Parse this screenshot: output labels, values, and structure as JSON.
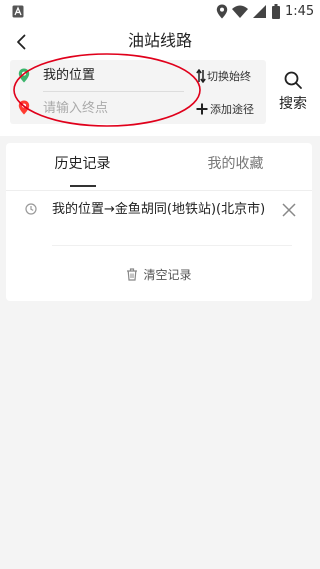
{
  "status_bar": {
    "time": "1:45"
  },
  "header": {
    "title": "油站线路"
  },
  "route": {
    "start_label": "我的位置",
    "end_placeholder": "请输入终点",
    "swap_label": "切换始终",
    "add_waypoint_label": "添加途径",
    "search_label": "搜索"
  },
  "colors": {
    "start_pin": "#3bb46b",
    "end_pin": "#ff3b30",
    "annotation": "#e0001b"
  },
  "tabs": [
    {
      "label": "历史记录",
      "active": true
    },
    {
      "label": "我的收藏",
      "active": false
    }
  ],
  "history": [
    {
      "text": "我的位置→金鱼胡同(地铁站)(北京市)"
    }
  ],
  "clear_label": "清空记录"
}
